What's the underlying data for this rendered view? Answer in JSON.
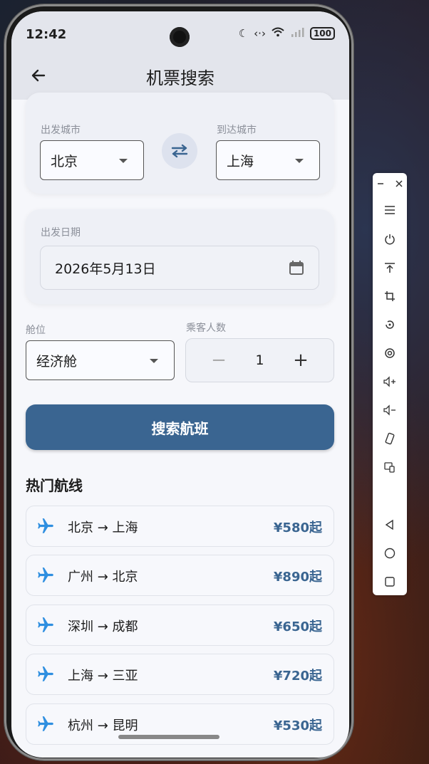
{
  "status": {
    "time": "12:42",
    "battery": "100"
  },
  "app": {
    "title": "机票搜索"
  },
  "form": {
    "from_label": "出发城市",
    "from_value": "北京",
    "to_label": "到达城市",
    "to_value": "上海",
    "date_label": "出发日期",
    "date_value": "2026年5月13日",
    "cabin_label": "舱位",
    "cabin_value": "经济舱",
    "pax_label": "乘客人数",
    "pax_value": "1",
    "pax_minus": "−",
    "pax_plus": "+",
    "search_button": "搜索航班"
  },
  "popular": {
    "title": "热门航线",
    "routes": [
      {
        "route": "北京 → 上海",
        "price": "¥580起"
      },
      {
        "route": "广州 → 北京",
        "price": "¥890起"
      },
      {
        "route": "深圳 → 成都",
        "price": "¥650起"
      },
      {
        "route": "上海 → 三亚",
        "price": "¥720起"
      },
      {
        "route": "杭州 → 昆明",
        "price": "¥530起"
      }
    ]
  },
  "colors": {
    "primary": "#3a6591",
    "plane": "#2f8fe0"
  }
}
